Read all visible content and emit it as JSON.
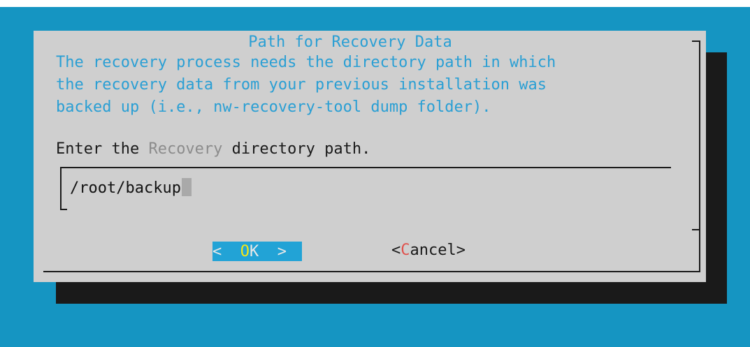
{
  "dialog": {
    "title": "Path for Recovery Data",
    "description_lines": [
      "The recovery process needs the directory path in which",
      "the recovery data from your previous installation was",
      "backed up (i.e., nw-recovery-tool dump folder)."
    ],
    "prompt_before": "Enter the ",
    "prompt_highlight": "Recovery",
    "prompt_after": " directory path."
  },
  "input": {
    "value": "/root/backup"
  },
  "buttons": {
    "ok": {
      "left": "<  ",
      "hotkey": "O",
      "rest": "K",
      "right": "  >"
    },
    "cancel": {
      "open": "<",
      "hotkey": "C",
      "rest": "ancel",
      "close": ">"
    }
  },
  "colors": {
    "background": "#1595c2",
    "dialog": "#cfcfcf",
    "text_accent": "#2a9fd4",
    "button_selected": "#22a3d6",
    "hotkey_selected": "#f5e617",
    "hotkey": "#e0504b"
  }
}
